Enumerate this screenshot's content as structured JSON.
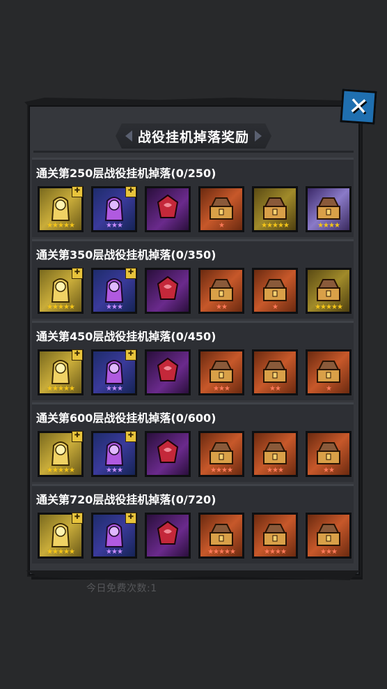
{
  "dialog": {
    "title": "战役挂机掉落奖励",
    "close_icon": "close-icon",
    "footer_faint_text": "今日免费次数:1"
  },
  "colors": {
    "panel": "#35373c",
    "row": "#2d2f34",
    "close_button": "#1f6fb0",
    "star": "#f5c518"
  },
  "tiers": [
    {
      "label": "通关第250层战役挂机掉落(0/250)",
      "items": [
        {
          "icon": "gold-hero-shard-icon",
          "quality": "gold",
          "stars": 5,
          "piece": true
        },
        {
          "icon": "purple-hero-shard-icon",
          "quality": "purple",
          "stars": 3,
          "piece": true
        },
        {
          "icon": "red-gem-icon",
          "quality": "violet",
          "stars": 0,
          "piece": false
        },
        {
          "icon": "treasure-chest-icon",
          "quality": "orange",
          "stars": 1,
          "piece": false
        },
        {
          "icon": "treasure-chest-icon",
          "quality": "dgold",
          "stars": 5,
          "piece": false
        },
        {
          "icon": "treasure-chest-icon",
          "quality": "lav",
          "stars": 4,
          "piece": false
        }
      ]
    },
    {
      "label": "通关第350层战役挂机掉落(0/350)",
      "items": [
        {
          "icon": "gold-hero-shard-icon",
          "quality": "gold",
          "stars": 5,
          "piece": true
        },
        {
          "icon": "purple-hero-shard-icon",
          "quality": "purple",
          "stars": 3,
          "piece": true
        },
        {
          "icon": "red-gem-icon",
          "quality": "violet",
          "stars": 0,
          "piece": false
        },
        {
          "icon": "treasure-chest-icon",
          "quality": "orange",
          "stars": 2,
          "piece": false
        },
        {
          "icon": "treasure-chest-icon",
          "quality": "orange",
          "stars": 1,
          "piece": false
        },
        {
          "icon": "treasure-chest-icon",
          "quality": "dgold",
          "stars": 5,
          "piece": false
        }
      ]
    },
    {
      "label": "通关第450层战役挂机掉落(0/450)",
      "items": [
        {
          "icon": "gold-hero-shard-icon",
          "quality": "gold",
          "stars": 5,
          "piece": true
        },
        {
          "icon": "purple-hero-shard-icon",
          "quality": "purple",
          "stars": 3,
          "piece": true
        },
        {
          "icon": "red-gem-icon",
          "quality": "violet",
          "stars": 0,
          "piece": false
        },
        {
          "icon": "treasure-chest-icon",
          "quality": "orange",
          "stars": 3,
          "piece": false
        },
        {
          "icon": "treasure-chest-icon",
          "quality": "orange",
          "stars": 2,
          "piece": false
        },
        {
          "icon": "treasure-chest-icon",
          "quality": "orange",
          "stars": 1,
          "piece": false
        }
      ]
    },
    {
      "label": "通关第600层战役挂机掉落(0/600)",
      "items": [
        {
          "icon": "gold-hero-shard-icon",
          "quality": "gold",
          "stars": 5,
          "piece": true
        },
        {
          "icon": "purple-hero-shard-icon",
          "quality": "purple",
          "stars": 3,
          "piece": true
        },
        {
          "icon": "red-gem-icon",
          "quality": "violet",
          "stars": 0,
          "piece": false
        },
        {
          "icon": "treasure-chest-icon",
          "quality": "orange",
          "stars": 4,
          "piece": false
        },
        {
          "icon": "treasure-chest-icon",
          "quality": "orange",
          "stars": 3,
          "piece": false
        },
        {
          "icon": "treasure-chest-icon",
          "quality": "orange",
          "stars": 2,
          "piece": false
        }
      ]
    },
    {
      "label": "通关第720层战役挂机掉落(0/720)",
      "items": [
        {
          "icon": "gold-hero-shard-icon",
          "quality": "gold",
          "stars": 5,
          "piece": true
        },
        {
          "icon": "purple-hero-shard-icon",
          "quality": "purple",
          "stars": 3,
          "piece": true
        },
        {
          "icon": "red-gem-icon",
          "quality": "violet",
          "stars": 0,
          "piece": false
        },
        {
          "icon": "treasure-chest-icon",
          "quality": "orange",
          "stars": 5,
          "piece": false
        },
        {
          "icon": "treasure-chest-icon",
          "quality": "orange",
          "stars": 4,
          "piece": false
        },
        {
          "icon": "treasure-chest-icon",
          "quality": "orange",
          "stars": 3,
          "piece": false
        }
      ]
    }
  ]
}
